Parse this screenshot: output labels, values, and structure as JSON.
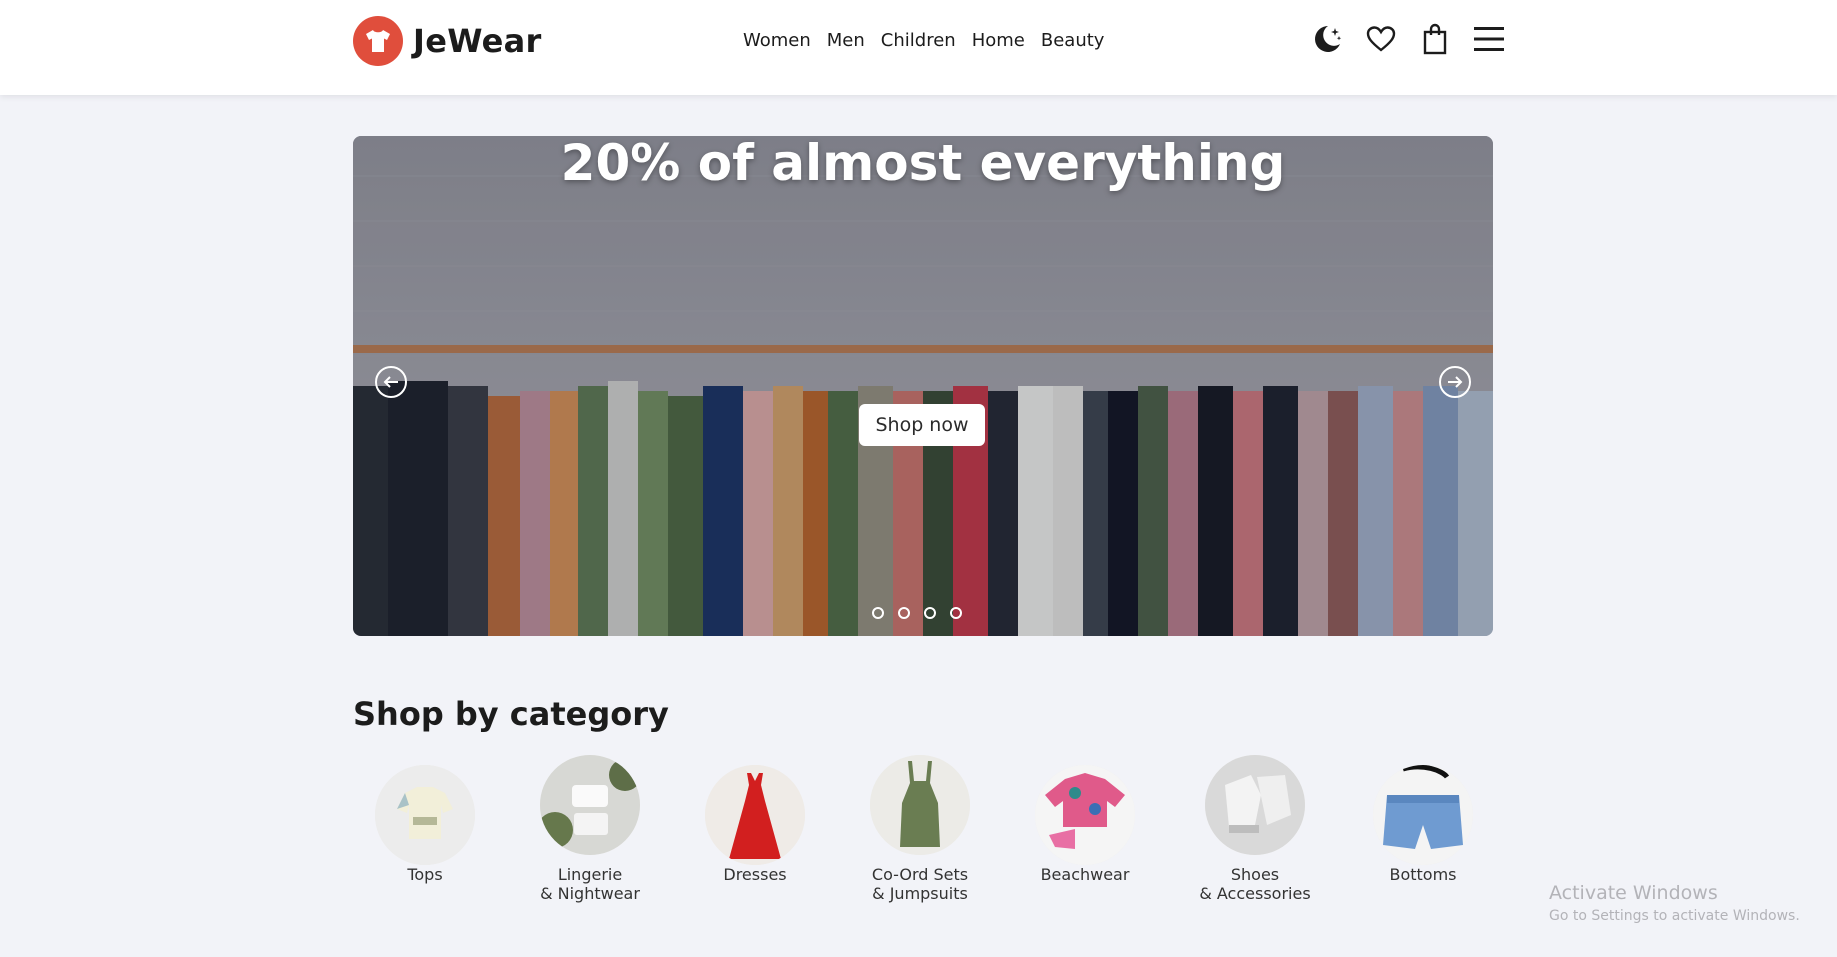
{
  "header": {
    "brand": "JeWear",
    "nav": [
      "Women",
      "Men",
      "Children",
      "Home",
      "Beauty"
    ],
    "icons": [
      "dark-mode-icon",
      "heart-icon",
      "shopping-bag-icon",
      "menu-icon"
    ]
  },
  "hero": {
    "title": "20% of almost everything",
    "cta": "Shop now",
    "slides": 4
  },
  "categories": {
    "title": "Shop by category",
    "items": [
      {
        "label": "Tops"
      },
      {
        "label": "Lingerie\n& Nightwear"
      },
      {
        "label": "Dresses"
      },
      {
        "label": "Co-Ord Sets\n& Jumpsuits"
      },
      {
        "label": "Beachwear"
      },
      {
        "label": "Shoes\n& Accessories"
      },
      {
        "label": "Bottoms"
      }
    ]
  },
  "watermark": {
    "line1": "Activate Windows",
    "line2": "Go to Settings to activate Windows."
  },
  "colors": {
    "brand": "#e04e3c",
    "background": "#f2f3f8"
  }
}
